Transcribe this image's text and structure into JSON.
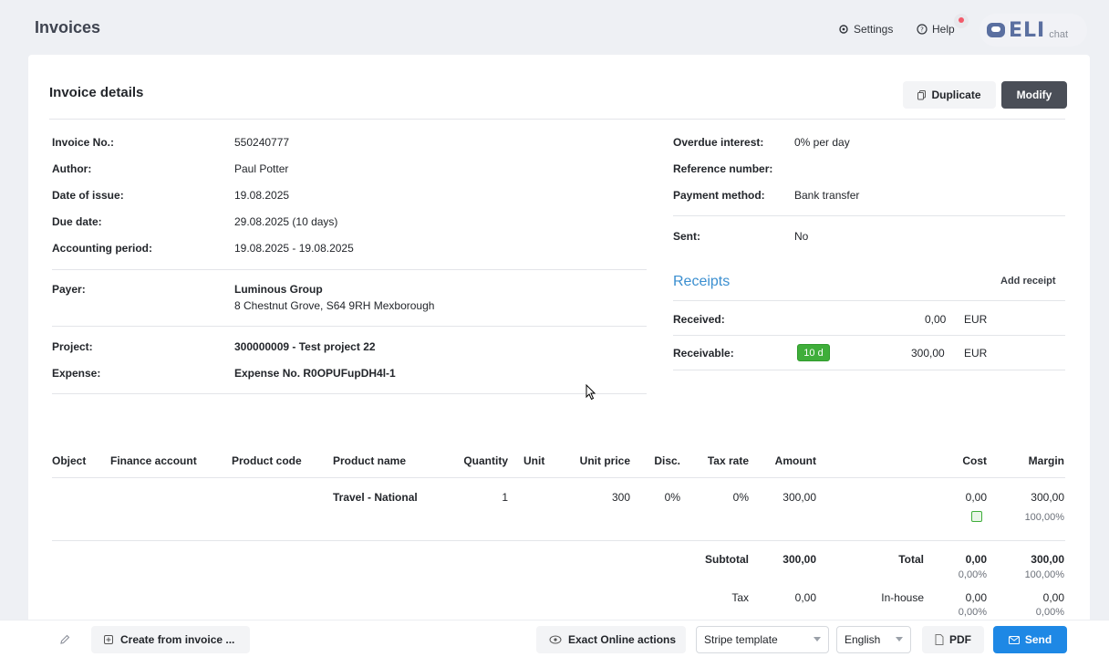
{
  "header": {
    "title": "Invoices",
    "settings_label": "Settings",
    "help_label": "Help",
    "eli_logo": "ELI",
    "eli_chat": "chat"
  },
  "card": {
    "title": "Invoice details",
    "duplicate_label": "Duplicate",
    "modify_label": "Modify"
  },
  "details": {
    "invoice_no_label": "Invoice No.:",
    "invoice_no": "550240777",
    "author_label": "Author:",
    "author": "Paul Potter",
    "date_label": "Date of issue:",
    "date": "19.08.2025",
    "due_label": "Due date:",
    "due": "29.08.2025 (10 days)",
    "period_label": "Accounting period:",
    "period": "19.08.2025 - 19.08.2025",
    "payer_label": "Payer:",
    "payer_name": "Luminous Group",
    "payer_address": "8 Chestnut Grove, S64 9RH Mexborough",
    "project_label": "Project:",
    "project": "300000009 - Test project 22",
    "expense_label": "Expense:",
    "expense": "Expense No. R0OPUFupDH4l-1"
  },
  "right": {
    "interest_label": "Overdue interest:",
    "interest": "0% per day",
    "ref_label": "Reference number:",
    "method_label": "Payment method:",
    "method": "Bank transfer",
    "sent_label": "Sent:",
    "sent": "No"
  },
  "receipts": {
    "title": "Receipts",
    "add_label": "Add receipt",
    "received_label": "Received:",
    "received_amount": "0,00",
    "received_currency": "EUR",
    "receivable_label": "Receivable:",
    "receivable_badge": "10 d",
    "receivable_amount": "300,00",
    "receivable_currency": "EUR"
  },
  "table": {
    "headers": [
      "Object",
      "Finance account",
      "Product code",
      "Product name",
      "Quantity",
      "Unit",
      "Unit price",
      "Disc.",
      "Tax rate",
      "Amount",
      "Cost",
      "Margin"
    ],
    "row": {
      "product_name": "Travel - National",
      "quantity": "1",
      "unit_price": "300",
      "disc": "0%",
      "tax_rate": "0%",
      "amount": "300,00",
      "cost": "0,00",
      "margin": "300,00",
      "margin_pct": "100,00%"
    }
  },
  "totals": {
    "subtotal_label": "Subtotal",
    "subtotal": "300,00",
    "total_label": "Total",
    "total_cost": "0,00",
    "total_cost_pct": "0,00%",
    "total_margin": "300,00",
    "total_margin_pct": "100,00%",
    "tax_label": "Tax",
    "tax": "0,00",
    "inhouse_label": "In-house",
    "inhouse_cost": "0,00",
    "inhouse_cost_pct": "0,00%",
    "inhouse_margin": "0,00",
    "inhouse_margin_pct": "0,00%"
  },
  "bottom": {
    "create_label": "Create from invoice ...",
    "exact_label": "Exact Online actions",
    "template_value": "Stripe template",
    "language_value": "English",
    "pdf_label": "PDF",
    "send_label": "Send"
  }
}
